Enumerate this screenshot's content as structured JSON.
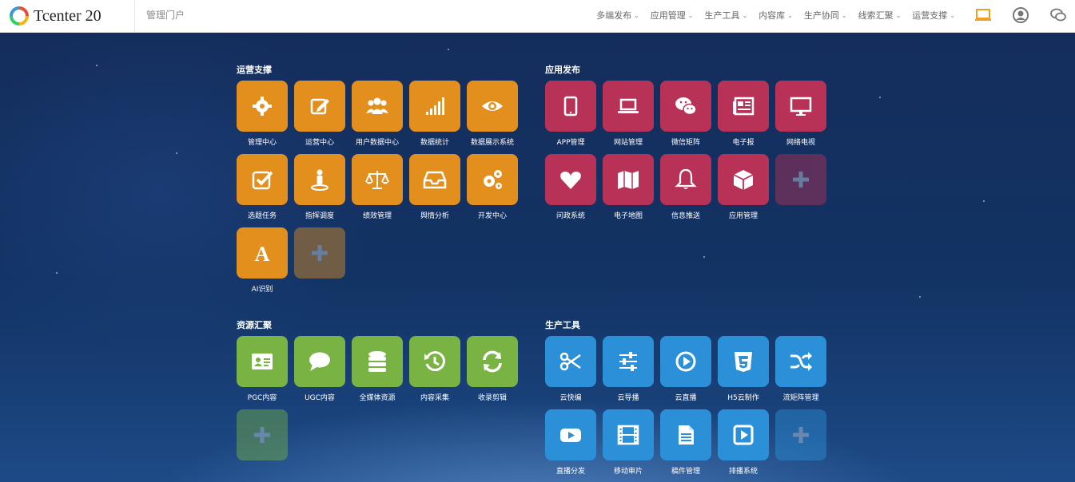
{
  "header": {
    "brand": "Tcenter 20",
    "portal_title": "管理门户",
    "nav": [
      "多端发布",
      "应用管理",
      "生产工具",
      "内容库",
      "生产协同",
      "线索汇聚",
      "运营支撑"
    ],
    "icons": [
      "laptop-icon",
      "user-icon",
      "chat-icon"
    ],
    "accent": "#f0a020"
  },
  "groups": {
    "ops": {
      "title": "运营支撑",
      "color": "#e38f1e",
      "tiles": [
        "管理中心",
        "运营中心",
        "用户数据中心",
        "数据统计",
        "数据展示系统",
        "选题任务",
        "指挥调度",
        "绩效管理",
        "舆情分析",
        "开发中心",
        "AI识别"
      ]
    },
    "app": {
      "title": "应用发布",
      "color": "#b83257",
      "tiles": [
        "APP管理",
        "网站管理",
        "微信矩阵",
        "电子报",
        "网络电视",
        "问政系统",
        "电子地图",
        "信息推送",
        "应用管理"
      ]
    },
    "res": {
      "title": "资源汇聚",
      "color": "#79b344",
      "tiles": [
        "PGC内容",
        "UGC内容",
        "全媒体资源",
        "内容采集",
        "收录剪辑"
      ]
    },
    "prod": {
      "title": "生产工具",
      "color": "#2c90d8",
      "tiles": [
        "云快编",
        "云导播",
        "云直播",
        "H5云制作",
        "流矩阵管理",
        "直播分发",
        "移动审片",
        "稿件管理",
        "排播系统"
      ]
    }
  }
}
